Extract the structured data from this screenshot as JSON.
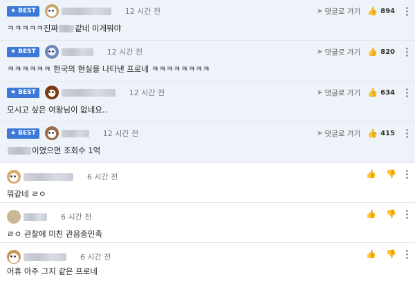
{
  "badge_label": "BEST",
  "reply_label": "댓글로 가기",
  "comments": [
    {
      "time": "12 시간 전",
      "text_before": "ㅋㅋㅋㅋㅋ진짜 ",
      "text_after": "같네 이게뭐야",
      "likes": "894"
    },
    {
      "time": "12 시간 전",
      "text": "ㅋㅋㅋㅋㅋㅋ 한국의 현실을 나타낸 프로네 ㅋㅋㅋㅋㅋㅋㅋㅋ",
      "likes": "820"
    },
    {
      "time": "12 시간 전",
      "text": "모시고 싶은 여왕님이 없네요..",
      "likes": "634"
    },
    {
      "time": "12 시간 전",
      "text_after": " 이였으면 조회수 1억",
      "likes": "415"
    },
    {
      "time": "6 시간 전",
      "text": "뭐같네 ㄹㅇ"
    },
    {
      "time": "6 시간 전",
      "text": "ㄹㅇ 관찰에 미친 관음중민족"
    },
    {
      "time": "6 시간 전",
      "text": "어휴 아주 그지 같은 프로네"
    }
  ]
}
